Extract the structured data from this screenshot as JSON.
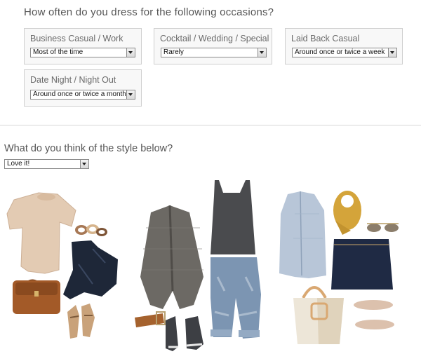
{
  "survey": {
    "occasions_question": "How often do you dress for the following occasions?",
    "occasions": [
      {
        "label": "Business Casual / Work",
        "selected": "Most of the time"
      },
      {
        "label": "Cocktail / Wedding / Special",
        "selected": "Rarely"
      },
      {
        "label": "Laid Back Casual",
        "selected": "Around once or twice a week"
      },
      {
        "label": "Date Night / Night Out",
        "selected": "Around once or twice a month"
      }
    ],
    "style_question": "What do you think of the style below?",
    "style_rating": "Love it!"
  },
  "outfits": [
    {
      "name": "outfit-1",
      "items": [
        "flowy blush top",
        "cuff bracelets",
        "dark skinny jeans",
        "cognac crossbody bag",
        "tan sandals"
      ]
    },
    {
      "name": "outfit-2",
      "items": [
        "grey knit cardigan",
        "charcoal tank top",
        "light wash boyfriend jeans",
        "cognac belt",
        "grey sneakers"
      ]
    },
    {
      "name": "outfit-3",
      "items": [
        "chambray sleeveless shirt",
        "mustard infinity scarf",
        "aviator sunglasses",
        "denim mini skirt",
        "cream tote bag",
        "nude ballet flats"
      ]
    }
  ],
  "colors": {
    "box_bg": "#f8f8f8",
    "box_border": "#cfcfcf",
    "text": "#555555",
    "divider": "#d6d6d6"
  }
}
